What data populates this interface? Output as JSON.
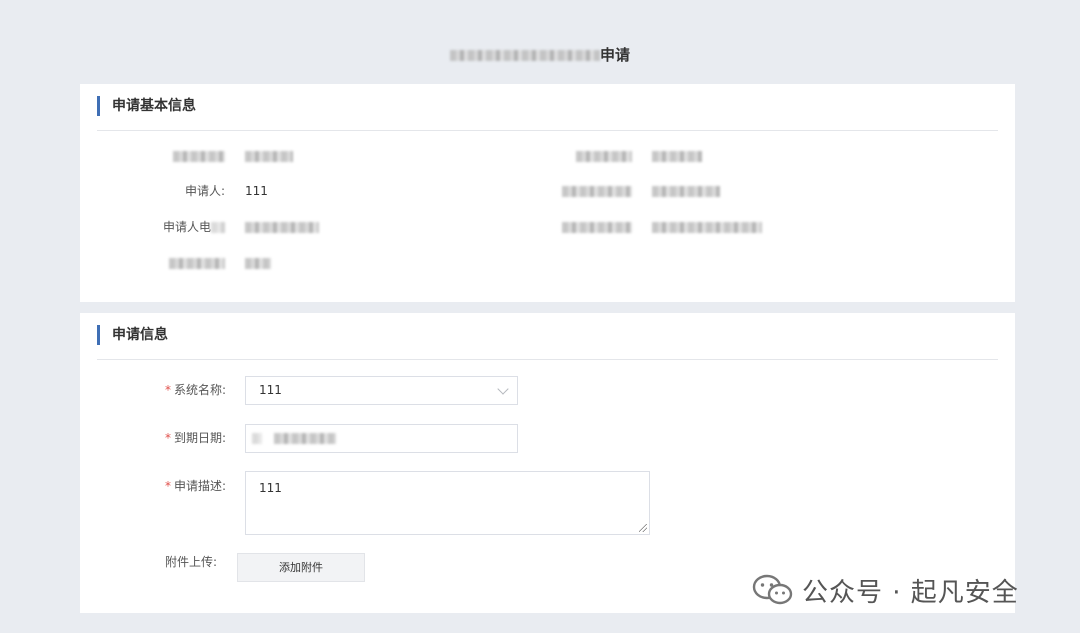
{
  "page": {
    "title_suffix": "申请"
  },
  "basic_info": {
    "section_title": "申请基本信息",
    "applicant_label": "申请人:",
    "applicant_value": "111",
    "applicant_phone_label_prefix": "申请人电"
  },
  "apply_info": {
    "section_title": "申请信息",
    "required_mark": "*",
    "system_name_label": "系统名称:",
    "system_name_value": "111",
    "expiry_date_label": "到期日期:",
    "description_label": "申请描述:",
    "description_value": "111",
    "attachment_label": "附件上传:",
    "add_attachment_button": "添加附件"
  },
  "watermark": {
    "text": "公众号 · 起凡安全"
  }
}
